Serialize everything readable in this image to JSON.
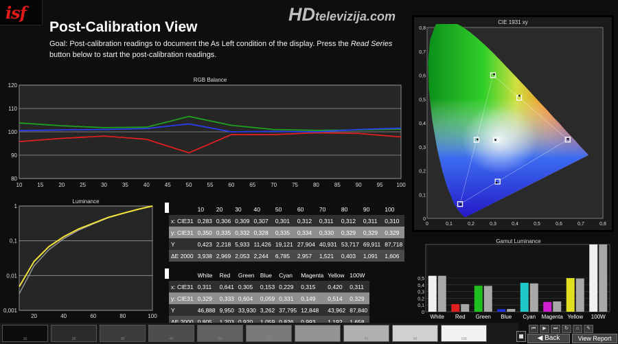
{
  "header": {
    "logo_text": "isf",
    "watermark_hd": "HD",
    "watermark_rest": "televizija.com",
    "title": "Post-Calibration View",
    "goal_prefix": "Goal: Post-calibration readings to document the As Left condition of the display. Press the ",
    "goal_emphasis": "Read Series",
    "goal_suffix": " button below to start the post-calibration readings."
  },
  "rgb_balance": {
    "title": "RGB Balance",
    "chart_data": {
      "type": "line",
      "x": [
        10,
        20,
        30,
        40,
        50,
        60,
        70,
        80,
        90,
        100
      ],
      "xticks": [
        10,
        15,
        20,
        25,
        30,
        35,
        40,
        45,
        50,
        55,
        60,
        65,
        70,
        75,
        80,
        85,
        90,
        95,
        100
      ],
      "yticks": [
        80,
        90,
        100,
        110,
        120
      ],
      "xlim": [
        10,
        100
      ],
      "ylim": [
        80,
        120
      ],
      "series": [
        {
          "color": "#e02020",
          "values": [
            95.8,
            97.2,
            98.2,
            96.8,
            91.0,
            98.8,
            98.8,
            99.6,
            99.3,
            97.8
          ]
        },
        {
          "color": "#1fa01f",
          "values": [
            103.8,
            102.6,
            101.8,
            102.0,
            106.6,
            102.8,
            101.0,
            100.6,
            100.8,
            101.2
          ]
        },
        {
          "color": "#2a3cf0",
          "values": [
            100.5,
            100.8,
            101.0,
            101.4,
            103.4,
            100.0,
            100.2,
            100.0,
            101.0,
            101.6
          ]
        }
      ]
    }
  },
  "luminance": {
    "title": "Luminance",
    "chart_data": {
      "type": "line",
      "x": [
        10,
        20,
        30,
        40,
        50,
        60,
        70,
        80,
        90,
        100
      ],
      "xticks": [
        20,
        40,
        60,
        80,
        100
      ],
      "yticks": [
        "0,001",
        "0,01",
        "0,1",
        "1"
      ],
      "xlim": [
        10,
        100
      ],
      "ylim": [
        0.001,
        1
      ],
      "log_y": true,
      "series": [
        {
          "color": "#f2e33a",
          "values": [
            0.00479,
            0.0253,
            0.0677,
            0.13,
            0.218,
            0.318,
            0.467,
            0.613,
            0.797,
            1.0
          ]
        },
        {
          "color": "#9a9a9a",
          "values": [
            0.003,
            0.019,
            0.055,
            0.115,
            0.2,
            0.305,
            0.455,
            0.61,
            0.8,
            1.0
          ]
        }
      ]
    }
  },
  "grayscale_table": {
    "columns": [
      "",
      "10",
      "20",
      "30",
      "40",
      "50",
      "60",
      "70",
      "80",
      "90",
      "100"
    ],
    "rows": [
      [
        "x: CIE31",
        "0,283",
        "0,306",
        "0,309",
        "0,307",
        "0,301",
        "0,312",
        "0,311",
        "0,312",
        "0,311",
        "0,310"
      ],
      [
        "y: CIE31",
        "0,350",
        "0,335",
        "0,332",
        "0,328",
        "0,335",
        "0,334",
        "0,330",
        "0,329",
        "0,329",
        "0,329"
      ],
      [
        "Y",
        "0,423",
        "2,218",
        "5,933",
        "11,426",
        "19,121",
        "27,904",
        "40,931",
        "53,717",
        "69,911",
        "87,718"
      ],
      [
        "ΔE 2000",
        "3,938",
        "2,969",
        "2,053",
        "2,244",
        "6,785",
        "2,957",
        "1,521",
        "0,403",
        "1,091",
        "1,606"
      ]
    ]
  },
  "gamut_table": {
    "columns": [
      "",
      "White",
      "Red",
      "Green",
      "Blue",
      "Cyan",
      "Magenta",
      "Yellow",
      "100W"
    ],
    "rows": [
      [
        "x: CIE31",
        "0,311",
        "0,641",
        "0,305",
        "0,153",
        "0,229",
        "0,315",
        "0,420",
        "0,311"
      ],
      [
        "y: CIE31",
        "0,329",
        "0,333",
        "0,604",
        "0,059",
        "0,331",
        "0,149",
        "0,514",
        "0,329"
      ],
      [
        "Y",
        "46,888",
        "9,950",
        "33,930",
        "3,262",
        "37,795",
        "12,848",
        "43,962",
        "87,840"
      ],
      [
        "ΔE 2000",
        "0,805",
        "1,203",
        "0,920",
        "1,059",
        "0,826",
        "0,993",
        "1,192",
        "1,658"
      ]
    ]
  },
  "cie": {
    "title": "CIE 1931 xy",
    "chart_data": {
      "type": "scatter",
      "xlim": [
        0,
        0.8
      ],
      "ylim": [
        0,
        0.8
      ],
      "xticks": [
        "0",
        "0,1",
        "0,2",
        "0,3",
        "0,4",
        "0,5",
        "0,6",
        "0,7",
        "0,8"
      ],
      "yticks": [
        "0",
        "0,1",
        "0,2",
        "0,3",
        "0,4",
        "0,5",
        "0,6",
        "0,7",
        "0,8"
      ],
      "target_gamut": [
        [
          0.64,
          0.33
        ],
        [
          0.3,
          0.6
        ],
        [
          0.15,
          0.06
        ]
      ],
      "targets": [
        [
          0.64,
          0.33
        ],
        [
          0.3,
          0.6
        ],
        [
          0.15,
          0.06
        ],
        [
          0.225,
          0.329
        ],
        [
          0.321,
          0.154
        ],
        [
          0.419,
          0.505
        ],
        [
          0.3127,
          0.329
        ]
      ],
      "measured": [
        [
          0.641,
          0.333
        ],
        [
          0.305,
          0.604
        ],
        [
          0.153,
          0.059
        ],
        [
          0.229,
          0.331
        ],
        [
          0.315,
          0.149
        ],
        [
          0.42,
          0.514
        ],
        [
          0.311,
          0.329
        ]
      ]
    }
  },
  "gamut_luminance": {
    "title": "Gamut Luminance",
    "chart_data": {
      "type": "bar",
      "categories": [
        "White",
        "Red",
        "Green",
        "Blue",
        "Cyan",
        "Magenta",
        "Yellow",
        "100W"
      ],
      "colors": [
        "#f0f0f0",
        "#e02020",
        "#20c020",
        "#2030e0",
        "#20c8c8",
        "#d020d0",
        "#e0e020",
        "#f0f0f0"
      ],
      "ylim": [
        0,
        1
      ],
      "yticks": [
        "0",
        "0,1",
        "0,2",
        "0,3",
        "0,4",
        "0,5"
      ],
      "measured": [
        0.534,
        0.113,
        0.386,
        0.037,
        0.43,
        0.146,
        0.5,
        1.0
      ],
      "target": [
        0.534,
        0.113,
        0.384,
        0.041,
        0.421,
        0.153,
        0.494,
        1.0
      ]
    }
  },
  "swatches": {
    "labels": [
      "10",
      "20",
      "30",
      "40",
      "50",
      "60",
      "70",
      "80",
      "90",
      "100"
    ],
    "colors": [
      "#0d0d0d",
      "#2b2b2b",
      "#3b3b3b",
      "#4d4d4d",
      "#616161",
      "#7a7a7a",
      "#939393",
      "#b0b0b0",
      "#d0d0d0",
      "#f2f2f2"
    ]
  },
  "controls": {
    "back_label": "Back",
    "report_label": "View Report"
  }
}
